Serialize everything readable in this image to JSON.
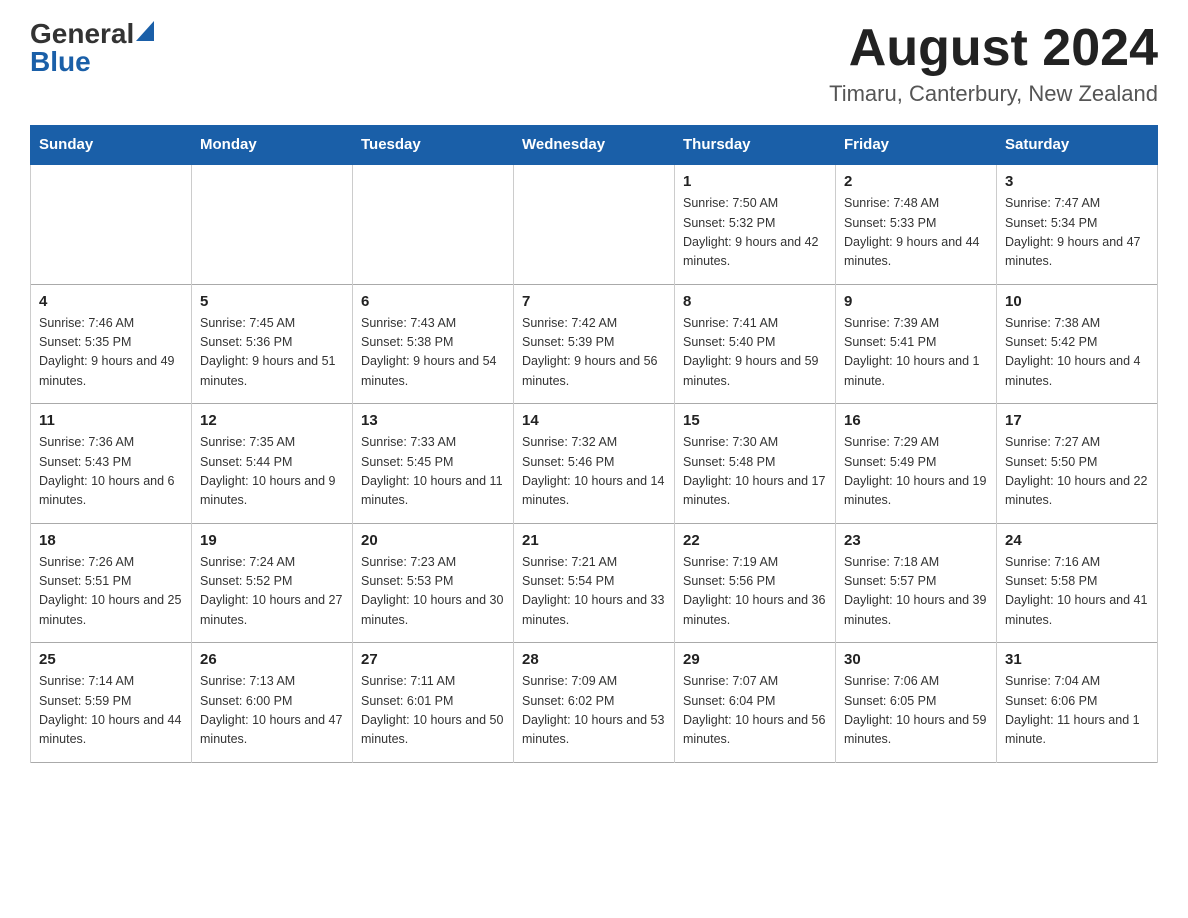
{
  "header": {
    "logo_general": "General",
    "logo_blue": "Blue",
    "month_title": "August 2024",
    "location": "Timaru, Canterbury, New Zealand"
  },
  "days_of_week": [
    "Sunday",
    "Monday",
    "Tuesday",
    "Wednesday",
    "Thursday",
    "Friday",
    "Saturday"
  ],
  "weeks": [
    [
      {
        "day": "",
        "sunrise": "",
        "sunset": "",
        "daylight": ""
      },
      {
        "day": "",
        "sunrise": "",
        "sunset": "",
        "daylight": ""
      },
      {
        "day": "",
        "sunrise": "",
        "sunset": "",
        "daylight": ""
      },
      {
        "day": "",
        "sunrise": "",
        "sunset": "",
        "daylight": ""
      },
      {
        "day": "1",
        "sunrise": "Sunrise: 7:50 AM",
        "sunset": "Sunset: 5:32 PM",
        "daylight": "Daylight: 9 hours and 42 minutes."
      },
      {
        "day": "2",
        "sunrise": "Sunrise: 7:48 AM",
        "sunset": "Sunset: 5:33 PM",
        "daylight": "Daylight: 9 hours and 44 minutes."
      },
      {
        "day": "3",
        "sunrise": "Sunrise: 7:47 AM",
        "sunset": "Sunset: 5:34 PM",
        "daylight": "Daylight: 9 hours and 47 minutes."
      }
    ],
    [
      {
        "day": "4",
        "sunrise": "Sunrise: 7:46 AM",
        "sunset": "Sunset: 5:35 PM",
        "daylight": "Daylight: 9 hours and 49 minutes."
      },
      {
        "day": "5",
        "sunrise": "Sunrise: 7:45 AM",
        "sunset": "Sunset: 5:36 PM",
        "daylight": "Daylight: 9 hours and 51 minutes."
      },
      {
        "day": "6",
        "sunrise": "Sunrise: 7:43 AM",
        "sunset": "Sunset: 5:38 PM",
        "daylight": "Daylight: 9 hours and 54 minutes."
      },
      {
        "day": "7",
        "sunrise": "Sunrise: 7:42 AM",
        "sunset": "Sunset: 5:39 PM",
        "daylight": "Daylight: 9 hours and 56 minutes."
      },
      {
        "day": "8",
        "sunrise": "Sunrise: 7:41 AM",
        "sunset": "Sunset: 5:40 PM",
        "daylight": "Daylight: 9 hours and 59 minutes."
      },
      {
        "day": "9",
        "sunrise": "Sunrise: 7:39 AM",
        "sunset": "Sunset: 5:41 PM",
        "daylight": "Daylight: 10 hours and 1 minute."
      },
      {
        "day": "10",
        "sunrise": "Sunrise: 7:38 AM",
        "sunset": "Sunset: 5:42 PM",
        "daylight": "Daylight: 10 hours and 4 minutes."
      }
    ],
    [
      {
        "day": "11",
        "sunrise": "Sunrise: 7:36 AM",
        "sunset": "Sunset: 5:43 PM",
        "daylight": "Daylight: 10 hours and 6 minutes."
      },
      {
        "day": "12",
        "sunrise": "Sunrise: 7:35 AM",
        "sunset": "Sunset: 5:44 PM",
        "daylight": "Daylight: 10 hours and 9 minutes."
      },
      {
        "day": "13",
        "sunrise": "Sunrise: 7:33 AM",
        "sunset": "Sunset: 5:45 PM",
        "daylight": "Daylight: 10 hours and 11 minutes."
      },
      {
        "day": "14",
        "sunrise": "Sunrise: 7:32 AM",
        "sunset": "Sunset: 5:46 PM",
        "daylight": "Daylight: 10 hours and 14 minutes."
      },
      {
        "day": "15",
        "sunrise": "Sunrise: 7:30 AM",
        "sunset": "Sunset: 5:48 PM",
        "daylight": "Daylight: 10 hours and 17 minutes."
      },
      {
        "day": "16",
        "sunrise": "Sunrise: 7:29 AM",
        "sunset": "Sunset: 5:49 PM",
        "daylight": "Daylight: 10 hours and 19 minutes."
      },
      {
        "day": "17",
        "sunrise": "Sunrise: 7:27 AM",
        "sunset": "Sunset: 5:50 PM",
        "daylight": "Daylight: 10 hours and 22 minutes."
      }
    ],
    [
      {
        "day": "18",
        "sunrise": "Sunrise: 7:26 AM",
        "sunset": "Sunset: 5:51 PM",
        "daylight": "Daylight: 10 hours and 25 minutes."
      },
      {
        "day": "19",
        "sunrise": "Sunrise: 7:24 AM",
        "sunset": "Sunset: 5:52 PM",
        "daylight": "Daylight: 10 hours and 27 minutes."
      },
      {
        "day": "20",
        "sunrise": "Sunrise: 7:23 AM",
        "sunset": "Sunset: 5:53 PM",
        "daylight": "Daylight: 10 hours and 30 minutes."
      },
      {
        "day": "21",
        "sunrise": "Sunrise: 7:21 AM",
        "sunset": "Sunset: 5:54 PM",
        "daylight": "Daylight: 10 hours and 33 minutes."
      },
      {
        "day": "22",
        "sunrise": "Sunrise: 7:19 AM",
        "sunset": "Sunset: 5:56 PM",
        "daylight": "Daylight: 10 hours and 36 minutes."
      },
      {
        "day": "23",
        "sunrise": "Sunrise: 7:18 AM",
        "sunset": "Sunset: 5:57 PM",
        "daylight": "Daylight: 10 hours and 39 minutes."
      },
      {
        "day": "24",
        "sunrise": "Sunrise: 7:16 AM",
        "sunset": "Sunset: 5:58 PM",
        "daylight": "Daylight: 10 hours and 41 minutes."
      }
    ],
    [
      {
        "day": "25",
        "sunrise": "Sunrise: 7:14 AM",
        "sunset": "Sunset: 5:59 PM",
        "daylight": "Daylight: 10 hours and 44 minutes."
      },
      {
        "day": "26",
        "sunrise": "Sunrise: 7:13 AM",
        "sunset": "Sunset: 6:00 PM",
        "daylight": "Daylight: 10 hours and 47 minutes."
      },
      {
        "day": "27",
        "sunrise": "Sunrise: 7:11 AM",
        "sunset": "Sunset: 6:01 PM",
        "daylight": "Daylight: 10 hours and 50 minutes."
      },
      {
        "day": "28",
        "sunrise": "Sunrise: 7:09 AM",
        "sunset": "Sunset: 6:02 PM",
        "daylight": "Daylight: 10 hours and 53 minutes."
      },
      {
        "day": "29",
        "sunrise": "Sunrise: 7:07 AM",
        "sunset": "Sunset: 6:04 PM",
        "daylight": "Daylight: 10 hours and 56 minutes."
      },
      {
        "day": "30",
        "sunrise": "Sunrise: 7:06 AM",
        "sunset": "Sunset: 6:05 PM",
        "daylight": "Daylight: 10 hours and 59 minutes."
      },
      {
        "day": "31",
        "sunrise": "Sunrise: 7:04 AM",
        "sunset": "Sunset: 6:06 PM",
        "daylight": "Daylight: 11 hours and 1 minute."
      }
    ]
  ]
}
